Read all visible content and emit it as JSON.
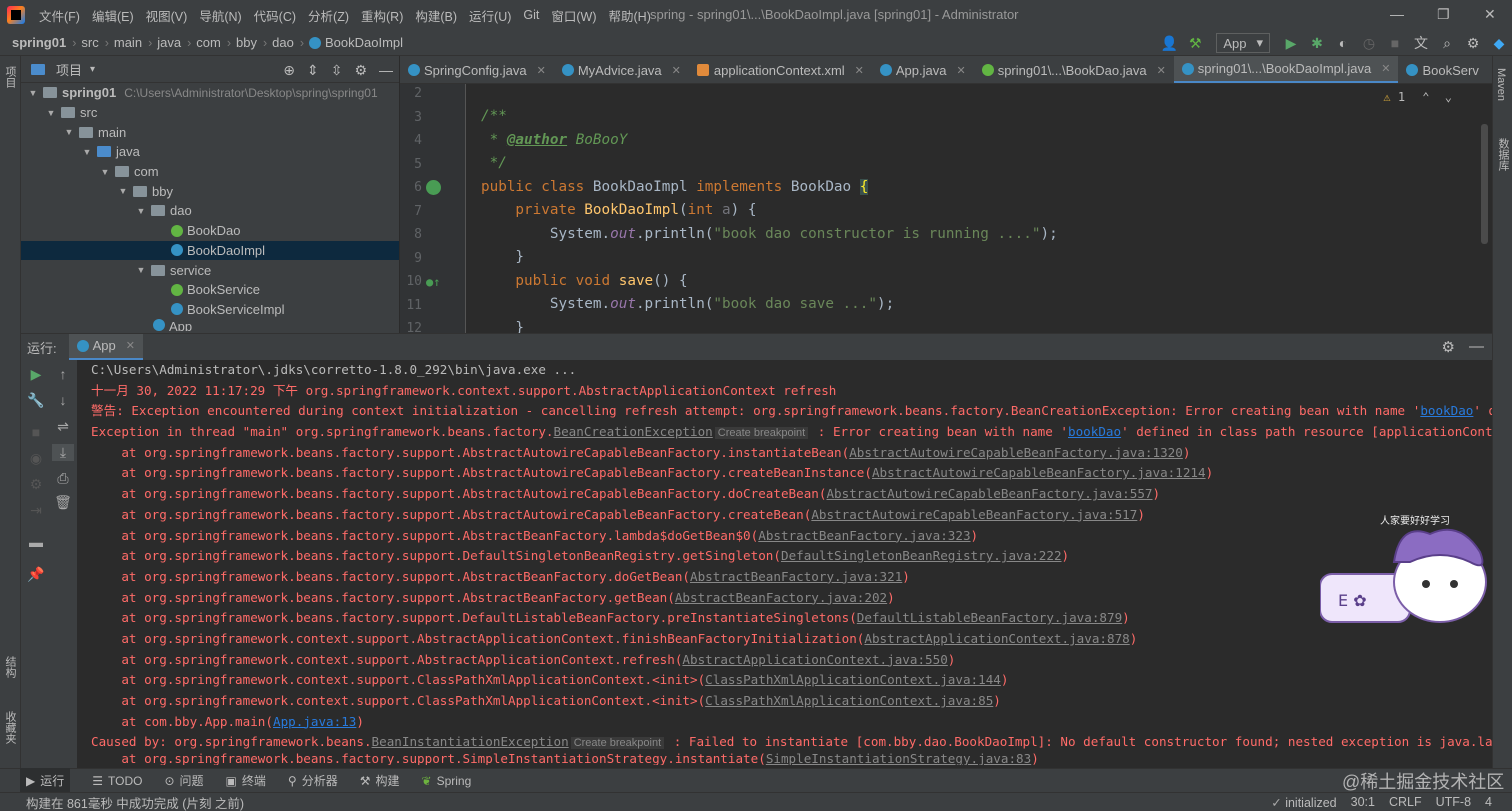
{
  "menu": [
    "文件(F)",
    "编辑(E)",
    "视图(V)",
    "导航(N)",
    "代码(C)",
    "分析(Z)",
    "重构(R)",
    "构建(B)",
    "运行(U)",
    "Git",
    "窗口(W)",
    "帮助(H)"
  ],
  "window_title": "spring - spring01\\...\\BookDaoImpl.java [spring01] - Administrator",
  "breadcrumbs": [
    "spring01",
    "src",
    "main",
    "java",
    "com",
    "bby",
    "dao",
    "BookDaoImpl"
  ],
  "run_config": "App",
  "left_strip": {
    "project": "项目",
    "structure": "结构",
    "bookmarks": "收藏夹"
  },
  "right_strip": {
    "maven": "Maven",
    "database": "数据库"
  },
  "project_panel": {
    "title": "项目",
    "tree": [
      {
        "label": "spring01",
        "path": "C:\\Users\\Administrator\\Desktop\\spring\\spring01"
      },
      {
        "label": "src"
      },
      {
        "label": "main"
      },
      {
        "label": "java"
      },
      {
        "label": "com"
      },
      {
        "label": "bby"
      },
      {
        "label": "dao"
      },
      {
        "label": "BookDao"
      },
      {
        "label": "BookDaoImpl"
      },
      {
        "label": "service"
      },
      {
        "label": "BookService"
      },
      {
        "label": "BookServiceImpl"
      },
      {
        "label": "App"
      }
    ]
  },
  "editor_tabs": [
    "SpringConfig.java",
    "MyAdvice.java",
    "applicationContext.xml",
    "App.java",
    "spring01\\...\\BookDao.java",
    "spring01\\...\\BookDaoImpl.java",
    "BookServ"
  ],
  "editor": {
    "warning_count": "1",
    "line_numbers": [
      "2",
      "3",
      "4",
      "5",
      "6",
      "7",
      "8",
      "9",
      "10",
      "11",
      "12"
    ],
    "lines": {
      "l3": "/**",
      "l4_prefix": " * ",
      "l4_tag": "@author",
      "l4_name": " BoBooY",
      "l5": " */",
      "l6_kw": "public class ",
      "l6_name": "BookDaoImpl ",
      "l6_kw2": "implements ",
      "l6_iface": "BookDao ",
      "l6_brace": "{",
      "l7_kw": "    private ",
      "l7_fn": "BookDaoImpl",
      "l7_open": "(",
      "l7_type": "int ",
      "l7_param": "a",
      "l7_close": ") {",
      "l8_a": "        System.",
      "l8_out": "out",
      "l8_b": ".println(",
      "l8_str": "\"book dao constructor is running ....\"",
      "l8_c": ");",
      "l9": "    }",
      "l10_kw": "    public void ",
      "l10_fn": "save",
      "l10_rest": "() {",
      "l11_a": "        System.",
      "l11_out": "out",
      "l11_b": ".println(",
      "l11_str": "\"book dao save ...\"",
      "l11_c": ");",
      "l12": "    }"
    }
  },
  "run_panel": {
    "label": "运行:",
    "tab": "App",
    "console": {
      "l1": "C:\\Users\\Administrator\\.jdks\\corretto-1.8.0_292\\bin\\java.exe ...",
      "l2": "十一月 30, 2022 11:17:29 下午 org.springframework.context.support.AbstractApplicationContext refresh",
      "l3_a": "警告: Exception encountered during context initialization - cancelling refresh attempt: org.springframework.beans.factory.BeanCreationException: Error creating bean with name '",
      "l3_link": "bookDao",
      "l3_b": "' defined in cl",
      "l4_a": "Exception in thread \"main\" org.springframework.beans.factory.",
      "l4_link": "BeanCreationException",
      "l4_hint": "Create breakpoint",
      "l4_b": " : Error creating bean with name '",
      "l4_link2": "bookDao",
      "l4_c": "' defined in class path resource [applicationContext.xml]: In",
      "stack": [
        {
          "text": "    at org.springframework.beans.factory.support.AbstractAutowireCapableBeanFactory.instantiateBean(",
          "link": "AbstractAutowireCapableBeanFactory.java:1320",
          "end": ")"
        },
        {
          "text": "    at org.springframework.beans.factory.support.AbstractAutowireCapableBeanFactory.createBeanInstance(",
          "link": "AbstractAutowireCapableBeanFactory.java:1214",
          "end": ")"
        },
        {
          "text": "    at org.springframework.beans.factory.support.AbstractAutowireCapableBeanFactory.doCreateBean(",
          "link": "AbstractAutowireCapableBeanFactory.java:557",
          "end": ")"
        },
        {
          "text": "    at org.springframework.beans.factory.support.AbstractAutowireCapableBeanFactory.createBean(",
          "link": "AbstractAutowireCapableBeanFactory.java:517",
          "end": ")"
        },
        {
          "text": "    at org.springframework.beans.factory.support.AbstractBeanFactory.lambda$doGetBean$0(",
          "link": "AbstractBeanFactory.java:323",
          "end": ")"
        },
        {
          "text": "    at org.springframework.beans.factory.support.DefaultSingletonBeanRegistry.getSingleton(",
          "link": "DefaultSingletonBeanRegistry.java:222",
          "end": ")"
        },
        {
          "text": "    at org.springframework.beans.factory.support.AbstractBeanFactory.doGetBean(",
          "link": "AbstractBeanFactory.java:321",
          "end": ")"
        },
        {
          "text": "    at org.springframework.beans.factory.support.AbstractBeanFactory.getBean(",
          "link": "AbstractBeanFactory.java:202",
          "end": ")"
        },
        {
          "text": "    at org.springframework.beans.factory.support.DefaultListableBeanFactory.preInstantiateSingletons(",
          "link": "DefaultListableBeanFactory.java:879",
          "end": ")"
        },
        {
          "text": "    at org.springframework.context.support.AbstractApplicationContext.finishBeanFactoryInitialization(",
          "link": "AbstractApplicationContext.java:878",
          "end": ")"
        },
        {
          "text": "    at org.springframework.context.support.AbstractApplicationContext.refresh(",
          "link": "AbstractApplicationContext.java:550",
          "end": ")"
        },
        {
          "text": "    at org.springframework.context.support.ClassPathXmlApplicationContext.<init>(",
          "link": "ClassPathXmlApplicationContext.java:144",
          "end": ")"
        },
        {
          "text": "    at org.springframework.context.support.ClassPathXmlApplicationContext.<init>(",
          "link": "ClassPathXmlApplicationContext.java:85",
          "end": ")"
        }
      ],
      "main_a": "    at com.bby.App.main(",
      "main_link": "App.java:13",
      "main_b": ")",
      "caused_a": "Caused by: org.springframework.beans.",
      "caused_link": "BeanInstantiationException",
      "caused_hint": "Create breakpoint",
      "caused_b": " : Failed to instantiate [com.bby.dao.BookDaoImpl]: No default constructor found; nested exception is java.lang.NoSuchMeth",
      "last_a": "    at org.springframework.beans.factory.support.SimpleInstantiationStrategy.instantiate(",
      "last_link": "SimpleInstantiationStrategy.java:83",
      "last_b": ")"
    }
  },
  "bottom_tabs": [
    "运行",
    "TODO",
    "问题",
    "终端",
    "分析器",
    "构建",
    "Spring"
  ],
  "status": {
    "message": "构建在 861毫秒 中成功完成 (片刻 之前)",
    "initialized": "initialized",
    "position": "30:1",
    "line_sep": "CRLF",
    "encoding": "UTF-8",
    "indent": "4"
  },
  "watermark": "@稀土掘金技术社区",
  "sticker_text": "人家要好好学习",
  "colors": {
    "accent": "#4a88c7",
    "error": "#ff6b68",
    "keyword": "#cc7832",
    "string": "#6a8759",
    "function": "#ffc66d"
  }
}
